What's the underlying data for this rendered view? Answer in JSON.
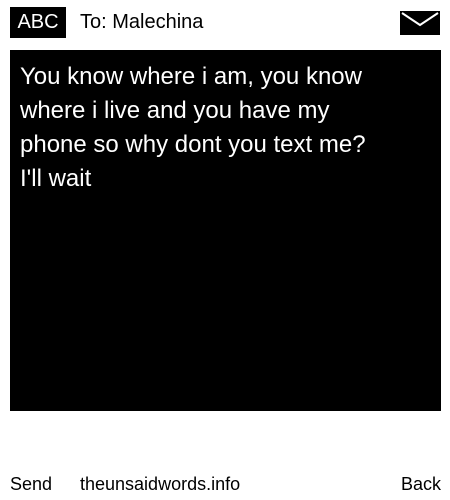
{
  "header": {
    "input_mode": "ABC",
    "recipient": "To: Malechina",
    "icon": "envelope-icon"
  },
  "message": {
    "text": "You know where i am, you know\nwhere i live and you have my\nphone so why dont you text me?\nI'll wait"
  },
  "footer": {
    "left_softkey": "Send",
    "site": "theunsaidwords.info",
    "right_softkey": "Back"
  },
  "colors": {
    "background": "#ffffff",
    "message_background": "#000000",
    "message_text": "#ffffff",
    "text": "#000000"
  }
}
